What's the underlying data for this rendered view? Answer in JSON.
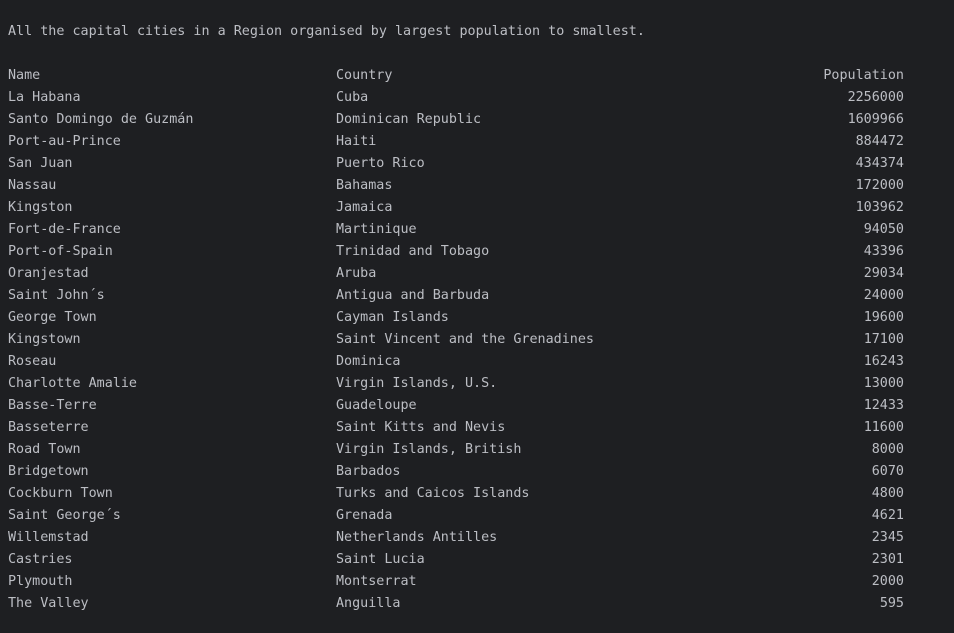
{
  "output": {
    "heading": "All the capital cities in a Region organised by largest population to smallest.",
    "columns": {
      "name": "Name",
      "country": "Country",
      "population": "Population"
    },
    "rows": [
      {
        "name": "La Habana",
        "country": "Cuba",
        "population": "2256000"
      },
      {
        "name": "Santo Domingo de Guzmán",
        "country": "Dominican Republic",
        "population": "1609966"
      },
      {
        "name": "Port-au-Prince",
        "country": "Haiti",
        "population": "884472"
      },
      {
        "name": "San Juan",
        "country": "Puerto Rico",
        "population": "434374"
      },
      {
        "name": "Nassau",
        "country": "Bahamas",
        "population": "172000"
      },
      {
        "name": "Kingston",
        "country": "Jamaica",
        "population": "103962"
      },
      {
        "name": "Fort-de-France",
        "country": "Martinique",
        "population": "94050"
      },
      {
        "name": "Port-of-Spain",
        "country": "Trinidad and Tobago",
        "population": "43396"
      },
      {
        "name": "Oranjestad",
        "country": "Aruba",
        "population": "29034"
      },
      {
        "name": "Saint John´s",
        "country": "Antigua and Barbuda",
        "population": "24000"
      },
      {
        "name": "George Town",
        "country": "Cayman Islands",
        "population": "19600"
      },
      {
        "name": "Kingstown",
        "country": "Saint Vincent and the Grenadines",
        "population": "17100"
      },
      {
        "name": "Roseau",
        "country": "Dominica",
        "population": "16243"
      },
      {
        "name": "Charlotte Amalie",
        "country": "Virgin Islands, U.S.",
        "population": "13000"
      },
      {
        "name": "Basse-Terre",
        "country": "Guadeloupe",
        "population": "12433"
      },
      {
        "name": "Basseterre",
        "country": "Saint Kitts and Nevis",
        "population": "11600"
      },
      {
        "name": "Road Town",
        "country": "Virgin Islands, British",
        "population": "8000"
      },
      {
        "name": "Bridgetown",
        "country": "Barbados",
        "population": "6070"
      },
      {
        "name": "Cockburn Town",
        "country": "Turks and Caicos Islands",
        "population": "4800"
      },
      {
        "name": "Saint George´s",
        "country": "Grenada",
        "population": "4621"
      },
      {
        "name": "Willemstad",
        "country": "Netherlands Antilles",
        "population": "2345"
      },
      {
        "name": "Castries",
        "country": "Saint Lucia",
        "population": "2301"
      },
      {
        "name": "Plymouth",
        "country": "Montserrat",
        "population": "2000"
      },
      {
        "name": "The Valley",
        "country": "Anguilla",
        "population": "595"
      }
    ]
  }
}
